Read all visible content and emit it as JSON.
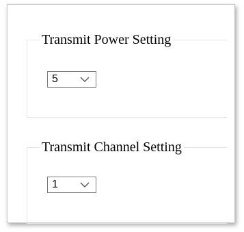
{
  "power_group": {
    "title": "Transmit Power Setting",
    "selected_value": "5",
    "dropdown_icon": "chevron-down-icon"
  },
  "channel_group": {
    "title": "Transmit Channel Setting",
    "selected_value": "1",
    "dropdown_icon": "chevron-down-icon"
  },
  "colors": {
    "border": "#7a7a7a",
    "group_border": "#e3e3e3",
    "text": "#000000",
    "background": "#ffffff"
  }
}
